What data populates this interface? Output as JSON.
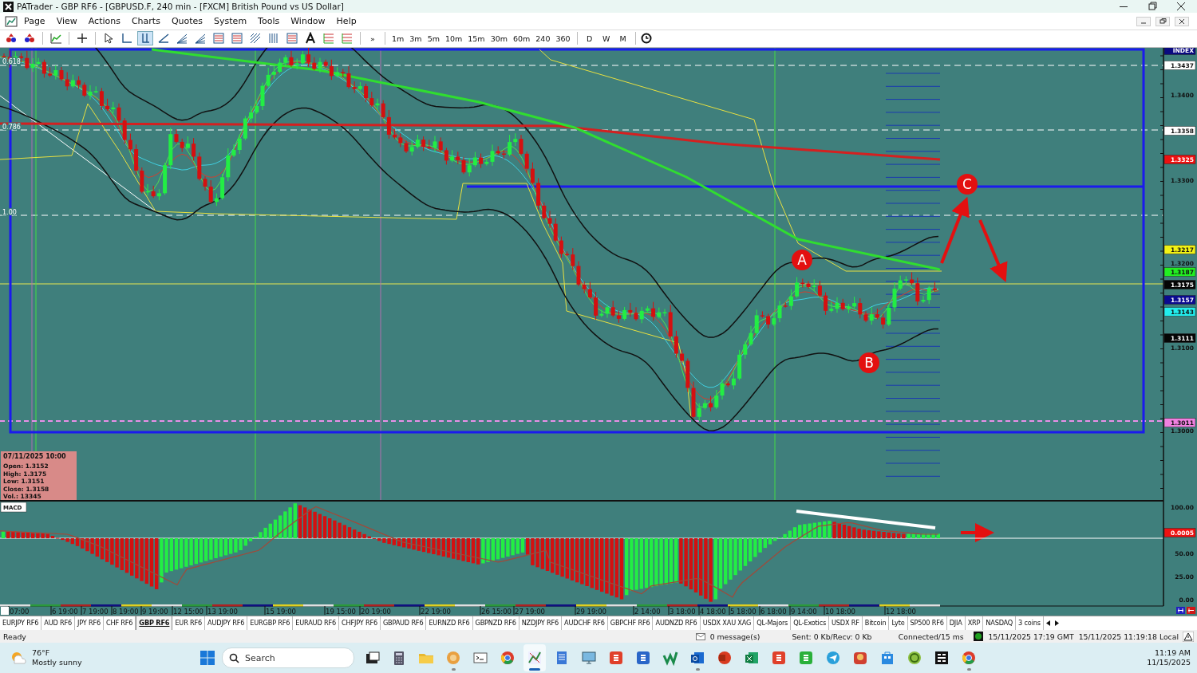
{
  "window": {
    "title": "PATrader - GBP RF6 - [GBPUSD.F, 240 min - [FXCM] British Pound vs US Dollar]"
  },
  "menu": [
    "Page",
    "View",
    "Actions",
    "Charts",
    "Quotes",
    "System",
    "Tools",
    "Window",
    "Help"
  ],
  "toolbar": {
    "tools": [
      {
        "kind": "profile-up",
        "selected": false
      },
      {
        "kind": "profile-down",
        "selected": false
      },
      {
        "kind": "chart",
        "selected": false
      },
      {
        "kind": "crosshair",
        "selected": false
      },
      {
        "kind": "cursor",
        "selected": false
      },
      {
        "kind": "corner",
        "selected": false
      },
      {
        "kind": "vertical",
        "selected": true
      },
      {
        "kind": "trendline",
        "selected": false
      },
      {
        "kind": "fan",
        "selected": false
      },
      {
        "kind": "fan",
        "selected": false
      },
      {
        "kind": "levels",
        "selected": false
      },
      {
        "kind": "levels",
        "selected": false
      },
      {
        "kind": "gann",
        "selected": false
      },
      {
        "kind": "cycles",
        "selected": false
      },
      {
        "kind": "levels",
        "selected": false
      },
      {
        "kind": "text",
        "selected": false
      },
      {
        "kind": "pivots",
        "selected": false
      },
      {
        "kind": "pivots",
        "selected": false
      }
    ],
    "more": "»",
    "timeframes": [
      {
        "label": "1m",
        "selected": false
      },
      {
        "label": "3m",
        "selected": false
      },
      {
        "label": "5m",
        "selected": false
      },
      {
        "label": "10m",
        "selected": false
      },
      {
        "label": "15m",
        "selected": false
      },
      {
        "label": "30m",
        "selected": false
      },
      {
        "label": "60m",
        "selected": false
      },
      {
        "label": "240",
        "selected": false
      },
      {
        "label": "360",
        "selected": false
      }
    ],
    "periods": [
      {
        "label": "D",
        "selected": false
      },
      {
        "label": "W",
        "selected": false
      },
      {
        "label": "M",
        "selected": false
      }
    ]
  },
  "chart": {
    "fib_levels": [
      "0.618",
      "0.786",
      "1.00"
    ],
    "price_axis": [
      {
        "kind": "tag",
        "text": "INDEX",
        "color": "#0a0a80"
      },
      {
        "kind": "tag",
        "text": "1.3437",
        "color": "#ffffff"
      },
      {
        "kind": "tick",
        "text": "1.3400"
      },
      {
        "kind": "tag",
        "text": "1.3358",
        "color": "#ffffff"
      },
      {
        "kind": "tag",
        "text": "1.3325",
        "color": "#ee1111"
      },
      {
        "kind": "tick",
        "text": "1.3300"
      },
      {
        "kind": "tag",
        "text": "1.3217",
        "color": "#f2f214"
      },
      {
        "kind": "tick",
        "text": "1.3200"
      },
      {
        "kind": "tag",
        "text": "1.3187",
        "color": "#22ee22"
      },
      {
        "kind": "tag",
        "text": "1.3175",
        "color": "#050505"
      },
      {
        "kind": "tag",
        "text": "1.3157",
        "color": "#0a0a90"
      },
      {
        "kind": "tag",
        "text": "1.3143",
        "color": "#22eeee"
      },
      {
        "kind": "tag",
        "text": "1.3111",
        "color": "#050505"
      },
      {
        "kind": "tick",
        "text": "1.3100"
      },
      {
        "kind": "tag",
        "text": "1.3011",
        "color": "#f080e0"
      },
      {
        "kind": "tick",
        "text": "1.3000"
      }
    ],
    "markers": [
      "A",
      "B",
      "C"
    ],
    "info": {
      "date": "07/11/2025 10:00",
      "lines": [
        "Open: 1.3152",
        "High: 1.3175",
        "Low: 1.3151",
        "Close: 1.3158",
        "Vol.: 13345"
      ]
    },
    "macd": {
      "label": "MACD",
      "axis": [
        {
          "kind": "tick",
          "text": "100.00"
        },
        {
          "kind": "tag",
          "text": "0.0005",
          "color": "#ee1111"
        },
        {
          "kind": "tick",
          "text": "50.00"
        },
        {
          "kind": "tick",
          "text": "25.00"
        },
        {
          "kind": "tick",
          "text": "0.00"
        }
      ]
    },
    "time_axis": [
      "07:00",
      "6 19:00",
      "7 19:00",
      "8 19:00",
      "9 19:00",
      "12 15:00",
      "13 19:00",
      "15 19:00",
      "19 15:00",
      "20 19:00",
      "22 19:00",
      "26 15:00",
      "27 19:00",
      "29 19:00",
      "2 14:00",
      "3 18:00",
      "4 18:00",
      "5 18:00",
      "6 18:00",
      "9 14:00",
      "10 18:00",
      "12 18:00"
    ]
  },
  "symbol_tabs": [
    {
      "label": "EURJPY RF6",
      "selected": false
    },
    {
      "label": "AUD RF6",
      "selected": false
    },
    {
      "label": "JPY RF6",
      "selected": false
    },
    {
      "label": "CHF RF6",
      "selected": false
    },
    {
      "label": "GBP RF6",
      "selected": true
    },
    {
      "label": "EUR RF6",
      "selected": false
    },
    {
      "label": "AUDJPY RF6",
      "selected": false
    },
    {
      "label": "EURGBP RF6",
      "selected": false
    },
    {
      "label": "EURAUD RF6",
      "selected": false
    },
    {
      "label": "CHFJPY RF6",
      "selected": false
    },
    {
      "label": "GBPAUD RF6",
      "selected": false
    },
    {
      "label": "EURNZD RF6",
      "selected": false
    },
    {
      "label": "GBPNZD RF6",
      "selected": false
    },
    {
      "label": "NZDJPY RF6",
      "selected": false
    },
    {
      "label": "AUDCHF RF6",
      "selected": false
    },
    {
      "label": "GBPCHF RF6",
      "selected": false
    },
    {
      "label": "AUDNZD RF6",
      "selected": false
    },
    {
      "label": "USDX XAU XAG",
      "selected": false
    },
    {
      "label": "QL-Majors",
      "selected": false
    },
    {
      "label": "QL-Exotics",
      "selected": false
    },
    {
      "label": "USDX RF",
      "selected": false
    },
    {
      "label": "Bitcoin",
      "selected": false
    },
    {
      "label": "Lyte",
      "selected": false
    },
    {
      "label": "SP500 RF6",
      "selected": false
    },
    {
      "label": "DJIA",
      "selected": false
    },
    {
      "label": "XRP",
      "selected": false
    },
    {
      "label": "NASDAQ",
      "selected": false
    },
    {
      "label": "3 coins",
      "selected": false
    }
  ],
  "status_bar": {
    "state": "Ready",
    "messages": "0 message(s)",
    "traffic": "Sent: 0 Kb/Recv: 0 Kb",
    "connection": "Connected/15 ms",
    "gmt_time": "15/11/2025 17:19 GMT",
    "local_time": "15/11/2025 11:19:18 Local"
  },
  "taskbar": {
    "weather": {
      "temperature": "76°F",
      "condition": "Mostly sunny"
    },
    "search": {
      "placeholder": "Search"
    },
    "apps": [
      {
        "kind": "taskview",
        "running": false,
        "selected": false
      },
      {
        "kind": "calculator",
        "running": false,
        "selected": false
      },
      {
        "kind": "folder",
        "running": false,
        "selected": false
      },
      {
        "kind": "bubble",
        "running": true,
        "selected": false
      },
      {
        "kind": "terminal",
        "running": false,
        "selected": false
      },
      {
        "kind": "browser",
        "running": false,
        "selected": false
      },
      {
        "kind": "chart",
        "running": true,
        "selected": true
      },
      {
        "kind": "notepad",
        "running": false,
        "selected": false
      },
      {
        "kind": "monitor",
        "running": false,
        "selected": false
      },
      {
        "kind": "tile-red",
        "running": false,
        "selected": false
      },
      {
        "kind": "tile-blue",
        "running": false,
        "selected": false
      },
      {
        "kind": "tick",
        "running": false,
        "selected": false
      },
      {
        "kind": "mail",
        "running": true,
        "selected": false
      },
      {
        "kind": "office",
        "running": false,
        "selected": false
      },
      {
        "kind": "sheet",
        "running": false,
        "selected": false
      },
      {
        "kind": "tile-red",
        "running": false,
        "selected": false
      },
      {
        "kind": "tile-green",
        "running": false,
        "selected": false
      },
      {
        "kind": "plane",
        "running": false,
        "selected": false
      },
      {
        "kind": "game",
        "running": false,
        "selected": false
      },
      {
        "kind": "store",
        "running": false,
        "selected": false
      },
      {
        "kind": "coin",
        "running": false,
        "selected": false
      },
      {
        "kind": "dark",
        "running": false,
        "selected": false
      },
      {
        "kind": "browser",
        "running": true,
        "selected": false
      }
    ],
    "time": "11:19 AM",
    "date": "11/15/2025"
  }
}
